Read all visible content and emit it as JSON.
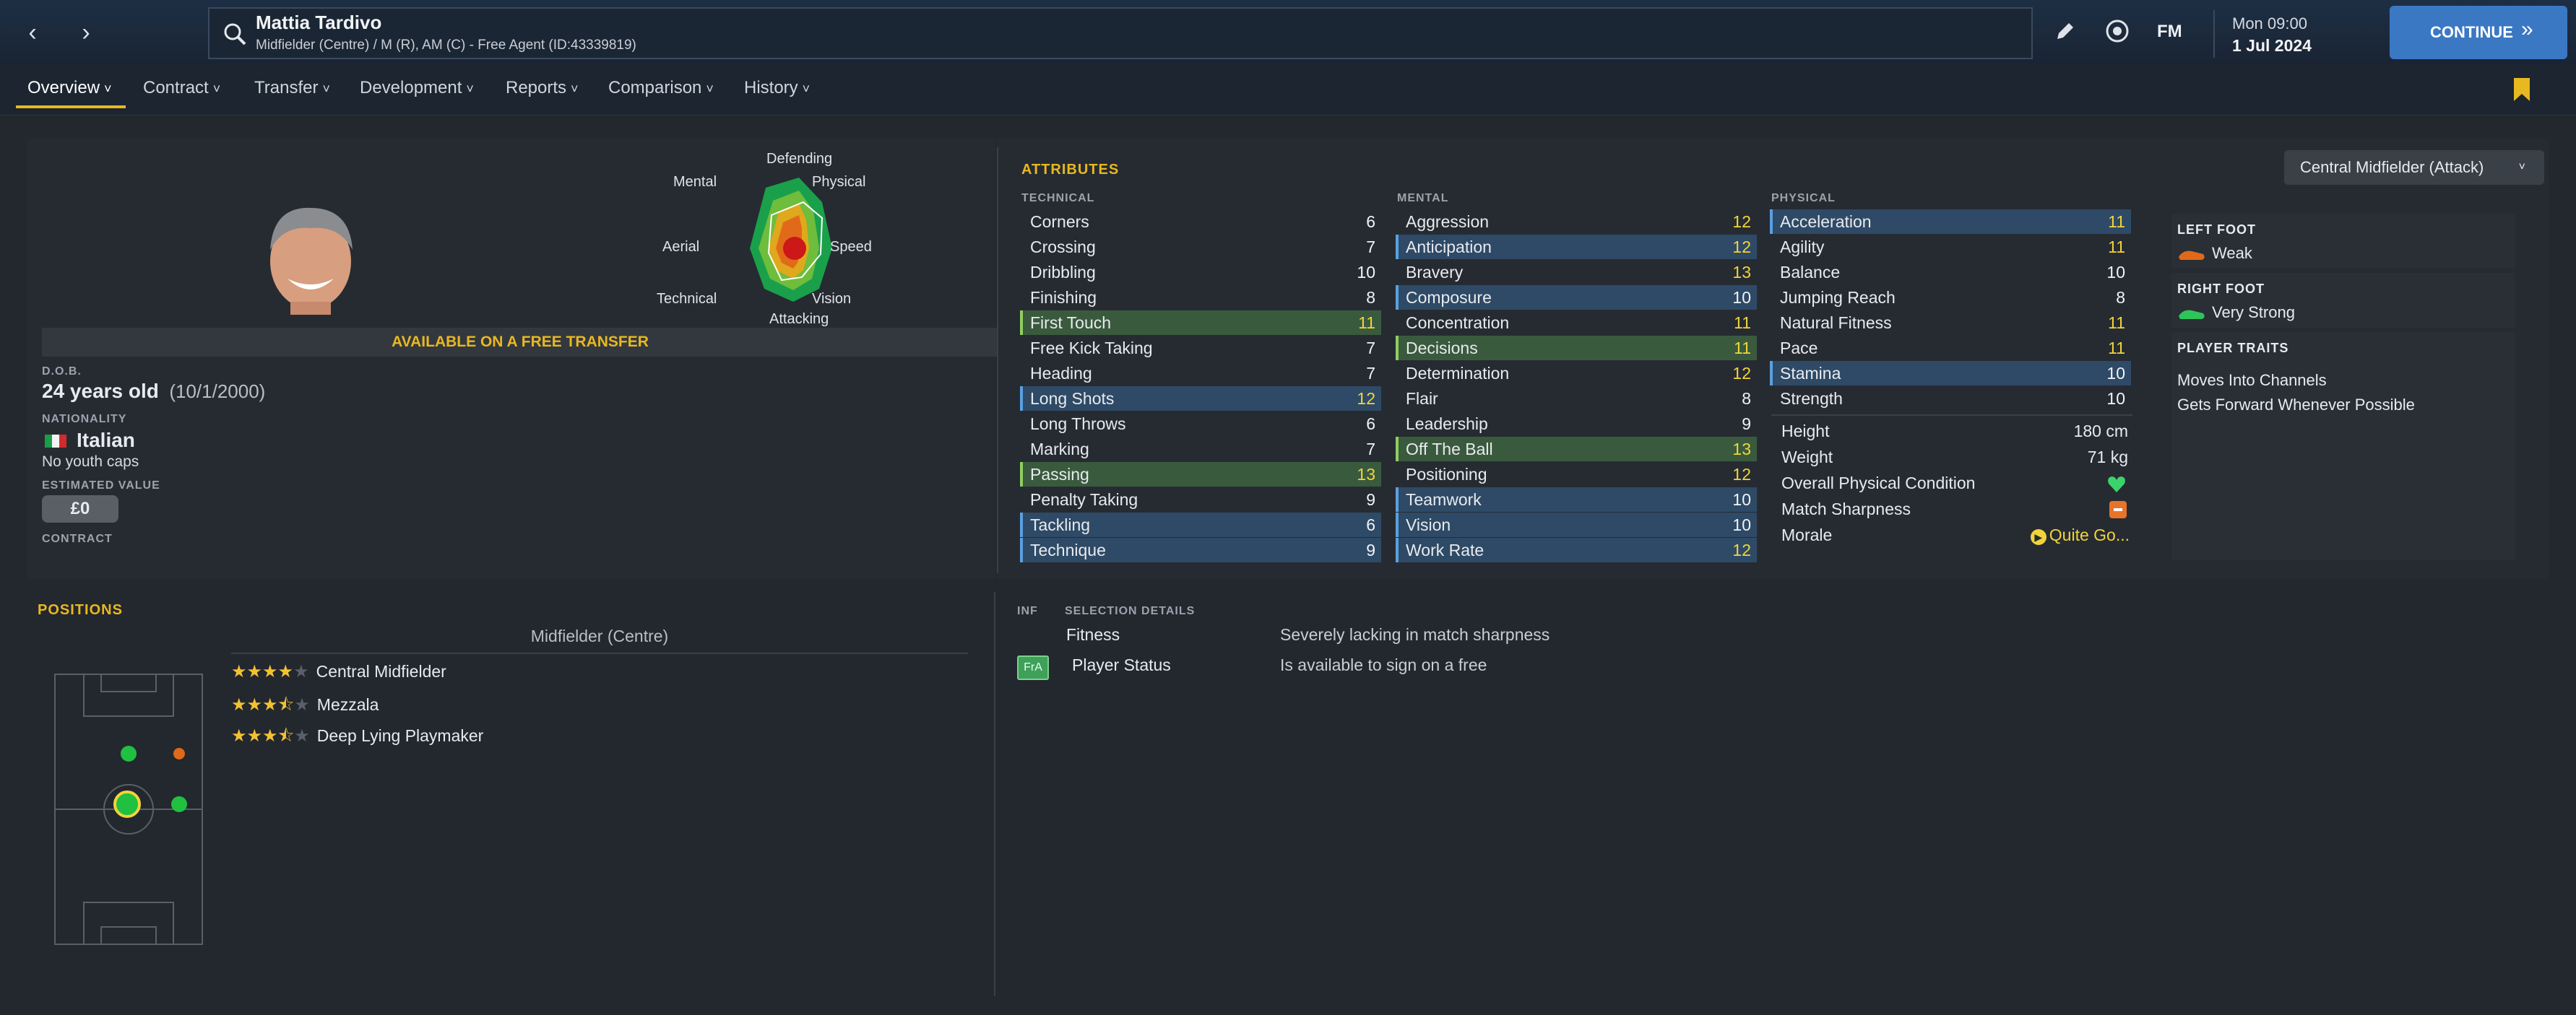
{
  "header": {
    "player_name": "Mattia Tardivo",
    "subtitle": "Midfielder (Centre) / M (R), AM (C) - Free Agent (ID:43339819)",
    "fm_label": "FM",
    "time": "Mon 09:00",
    "date": "1 Jul 2024",
    "continue_label": "CONTINUE"
  },
  "tabs": [
    "Overview",
    "Contract",
    "Transfer",
    "Development",
    "Reports",
    "Comparison",
    "History"
  ],
  "radar": {
    "labels": {
      "top": "Defending",
      "top_right": "Physical",
      "right": "Speed",
      "bottom_right": "Vision",
      "bottom": "Attacking",
      "bottom_left": "Technical",
      "left": "Aerial",
      "top_left": "Mental"
    }
  },
  "profile": {
    "availability": "AVAILABLE ON A FREE TRANSFER",
    "dob_label": "D.O.B.",
    "age": "24 years old",
    "dob": "(10/1/2000)",
    "nationality_label": "NATIONALITY",
    "nationality": "Italian",
    "caps": "No youth caps",
    "value_label": "ESTIMATED VALUE",
    "value": "£0",
    "contract_label": "CONTRACT"
  },
  "attributes": {
    "title": "ATTRIBUTES",
    "role_select": "Central Midfielder (Attack)",
    "technical_label": "TECHNICAL",
    "mental_label": "MENTAL",
    "physical_label": "PHYSICAL",
    "technical": [
      [
        "Corners",
        "6"
      ],
      [
        "Crossing",
        "7"
      ],
      [
        "Dribbling",
        "10"
      ],
      [
        "Finishing",
        "8"
      ],
      [
        "First Touch",
        "11"
      ],
      [
        "Free Kick Taking",
        "7"
      ],
      [
        "Heading",
        "7"
      ],
      [
        "Long Shots",
        "12"
      ],
      [
        "Long Throws",
        "6"
      ],
      [
        "Marking",
        "7"
      ],
      [
        "Passing",
        "13"
      ],
      [
        "Penalty Taking",
        "9"
      ],
      [
        "Tackling",
        "6"
      ],
      [
        "Technique",
        "9"
      ]
    ],
    "mental": [
      [
        "Aggression",
        "12"
      ],
      [
        "Anticipation",
        "12"
      ],
      [
        "Bravery",
        "13"
      ],
      [
        "Composure",
        "10"
      ],
      [
        "Concentration",
        "11"
      ],
      [
        "Decisions",
        "11"
      ],
      [
        "Determination",
        "12"
      ],
      [
        "Flair",
        "8"
      ],
      [
        "Leadership",
        "9"
      ],
      [
        "Off The Ball",
        "13"
      ],
      [
        "Positioning",
        "12"
      ],
      [
        "Teamwork",
        "10"
      ],
      [
        "Vision",
        "10"
      ],
      [
        "Work Rate",
        "12"
      ]
    ],
    "physical": [
      [
        "Acceleration",
        "11"
      ],
      [
        "Agility",
        "11"
      ],
      [
        "Balance",
        "10"
      ],
      [
        "Jumping Reach",
        "8"
      ],
      [
        "Natural Fitness",
        "11"
      ],
      [
        "Pace",
        "11"
      ],
      [
        "Stamina",
        "10"
      ],
      [
        "Strength",
        "10"
      ]
    ],
    "height_label": "Height",
    "height": "180 cm",
    "weight_label": "Weight",
    "weight": "71 kg",
    "condition_label": "Overall Physical Condition",
    "sharpness_label": "Match Sharpness",
    "morale_label": "Morale",
    "morale": "Quite Go..."
  },
  "feet": {
    "left_label": "LEFT FOOT",
    "left": "Weak",
    "right_label": "RIGHT FOOT",
    "right": "Very Strong"
  },
  "traits": {
    "title": "PLAYER TRAITS",
    "items": [
      "Moves Into Channels",
      "Gets Forward Whenever Possible"
    ]
  },
  "positions": {
    "title": "POSITIONS",
    "main": "Midfielder (Centre)",
    "roles": [
      {
        "name": "Central Midfielder",
        "stars": 4
      },
      {
        "name": "Mezzala",
        "stars": 3.5
      },
      {
        "name": "Deep Lying Playmaker",
        "stars": 3.5
      }
    ]
  },
  "selection": {
    "inf_label": "INF",
    "title": "SELECTION DETAILS",
    "badge": "FrA",
    "rows": [
      [
        "Fitness",
        "Severely lacking in match sharpness"
      ],
      [
        "Player Status",
        "Is available to sign on a free"
      ]
    ]
  },
  "colors": {
    "accent": "#e8b820",
    "continue_bg": "#3b78c4",
    "blue_hl": "#2e4a66",
    "green_hl": "#3a5a3e"
  }
}
